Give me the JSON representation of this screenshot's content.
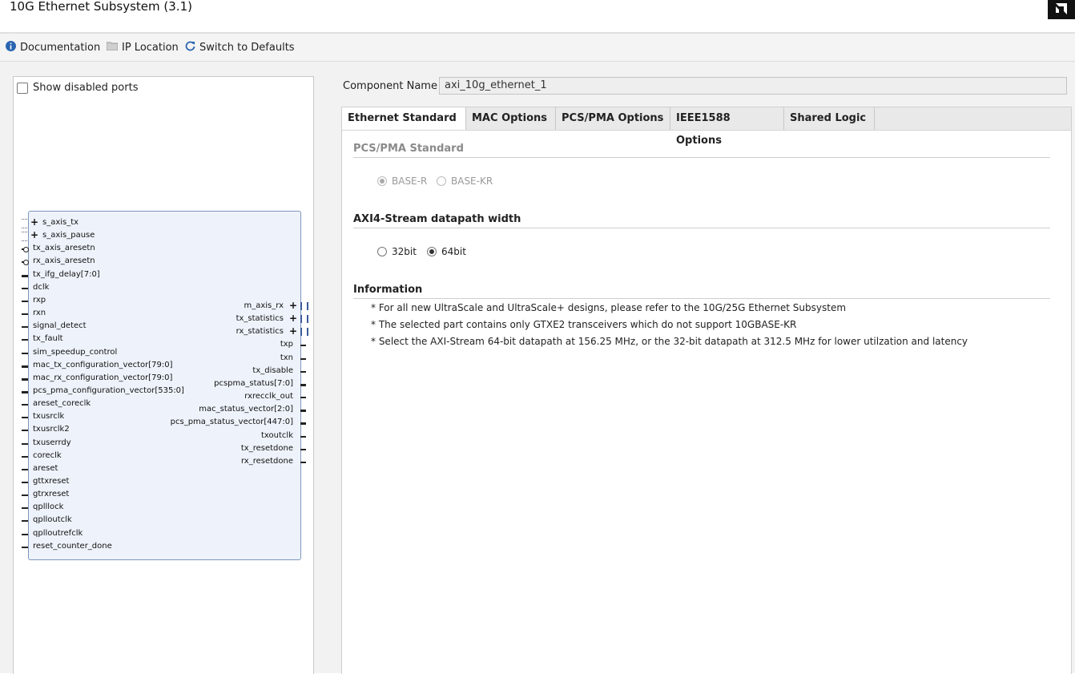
{
  "window": {
    "title": "10G Ethernet Subsystem (3.1)"
  },
  "toolbar": {
    "documentation": "Documentation",
    "ip_location": "IP Location",
    "switch_defaults": "Switch to Defaults"
  },
  "left": {
    "show_disabled_ports": "Show disabled ports",
    "left_ports": [
      "s_axis_tx",
      "s_axis_pause",
      "tx_axis_aresetn",
      "rx_axis_aresetn",
      "tx_ifg_delay[7:0]",
      "dclk",
      "rxp",
      "rxn",
      "signal_detect",
      "tx_fault",
      "sim_speedup_control",
      "mac_tx_configuration_vector[79:0]",
      "mac_rx_configuration_vector[79:0]",
      "pcs_pma_configuration_vector[535:0]",
      "areset_coreclk",
      "txusrclk",
      "txusrclk2",
      "txuserrdy",
      "coreclk",
      "areset",
      "gttxreset",
      "gtrxreset",
      "qplllock",
      "qplloutclk",
      "qplloutrefclk",
      "reset_counter_done"
    ],
    "right_ports": [
      "m_axis_rx",
      "tx_statistics",
      "rx_statistics",
      "txp",
      "txn",
      "tx_disable",
      "pcspma_status[7:0]",
      "rxrecclk_out",
      "mac_status_vector[2:0]",
      "pcs_pma_status_vector[447:0]",
      "txoutclk",
      "tx_resetdone",
      "rx_resetdone"
    ]
  },
  "component": {
    "label": "Component Name",
    "value": "axi_10g_ethernet_1"
  },
  "tabs": [
    "Ethernet Standard",
    "MAC Options",
    "PCS/PMA Options",
    "IEEE1588 Options",
    "Shared Logic"
  ],
  "pcs_pma": {
    "title": "PCS/PMA Standard",
    "options": [
      "BASE-R",
      "BASE-KR"
    ],
    "selected": "BASE-R"
  },
  "axi": {
    "title": "AXI4-Stream datapath width",
    "options": [
      "32bit",
      "64bit"
    ],
    "selected": "64bit"
  },
  "information": {
    "title": "Information",
    "lines": [
      "* For all new UltraScale and UltraScale+ designs, please refer to the 10G/25G Ethernet Subsystem",
      "* The selected part contains only GTXE2 transceivers which do not support 10GBASE-KR",
      "* Select the AXI-Stream 64-bit datapath at 156.25 MHz, or the 32-bit datapath at 312.5 MHz for lower utilzation and latency"
    ]
  }
}
